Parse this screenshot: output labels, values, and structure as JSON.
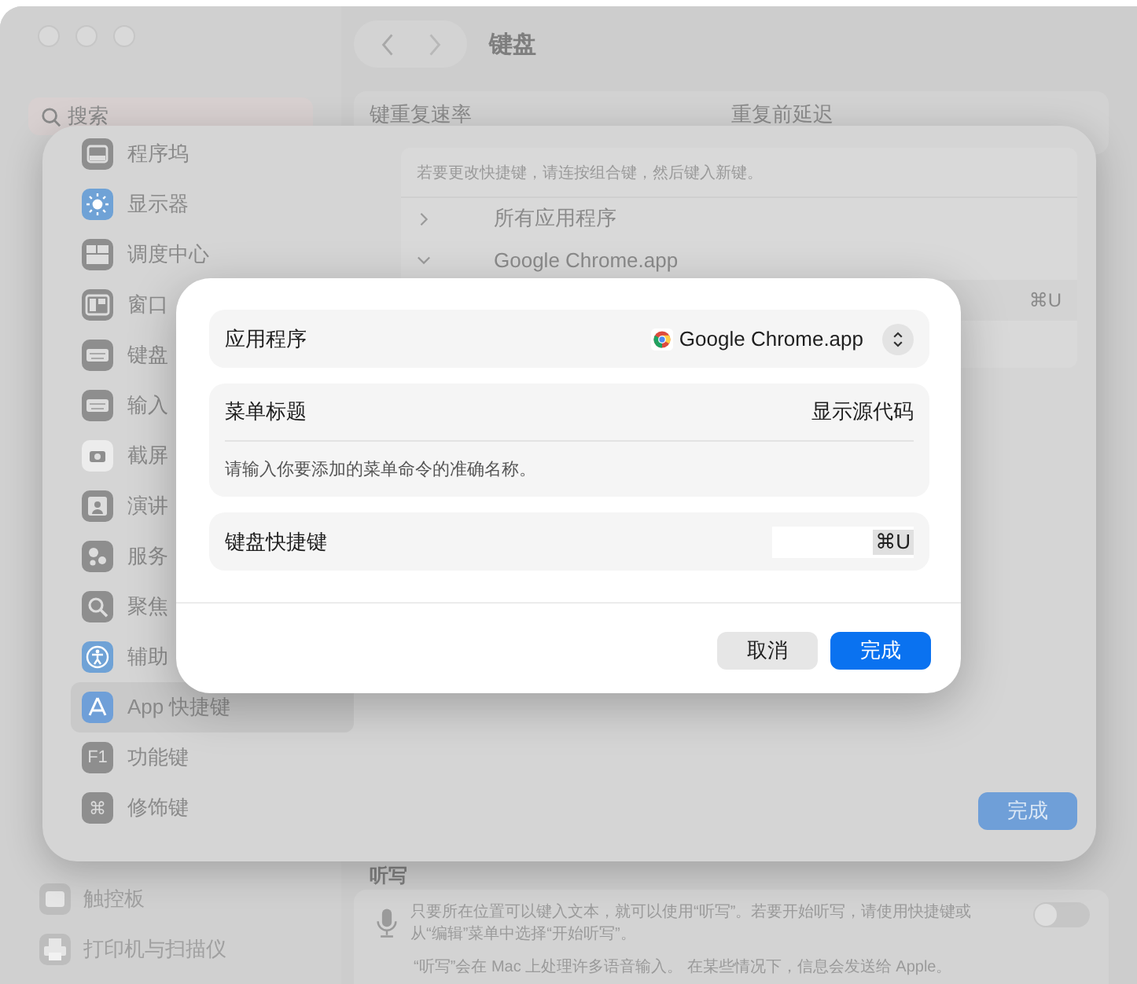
{
  "window": {
    "title": "键盘",
    "search": {
      "placeholder": "搜索"
    },
    "sidebar_items": [
      {
        "label": "触控板",
        "kind": "trackpad"
      },
      {
        "label": "打印机与扫描仪",
        "kind": "printer"
      }
    ],
    "key_repeat": {
      "labels": [
        "键重复速率",
        "重复前延迟"
      ]
    },
    "dictation": {
      "title": "听写",
      "description": "只要所在位置可以键入文本，就可以使用“听写”。若要开始听写，请使用快捷键或从“编辑”菜单中选择“开始听写”。",
      "note": "“听写”会在 Mac 上处理许多语音输入。 在某些情况下，信息会发送给 Apple。",
      "on": false
    }
  },
  "sheet": {
    "sidebar": [
      {
        "label": "程序坞",
        "kind": "dock",
        "selected": false
      },
      {
        "label": "显示器",
        "kind": "display",
        "selected": false
      },
      {
        "label": "调度中心",
        "kind": "mission",
        "selected": false
      },
      {
        "label": "窗口",
        "kind": "window",
        "selected": false
      },
      {
        "label": "键盘",
        "kind": "keyboard",
        "selected": false
      },
      {
        "label": "输入",
        "kind": "keyboard",
        "selected": false
      },
      {
        "label": "截屏",
        "kind": "screenshot",
        "selected": false
      },
      {
        "label": "演讲",
        "kind": "presenter",
        "selected": false
      },
      {
        "label": "服务",
        "kind": "services",
        "selected": false
      },
      {
        "label": "聚焦",
        "kind": "spotlight",
        "selected": false
      },
      {
        "label": "辅助",
        "kind": "accessibility",
        "selected": false
      },
      {
        "label": "App 快捷键",
        "kind": "appstore",
        "selected": true
      },
      {
        "label": "功能键",
        "kind": "glyph",
        "glyph": "F1",
        "selected": false
      },
      {
        "label": "修饰键",
        "kind": "glyph",
        "glyph": "⌘",
        "selected": false
      }
    ],
    "hint": "若要更改快捷键，请连按组合键，然后键入新键。",
    "rows": [
      {
        "kind": "group",
        "label": "所有应用程序",
        "expanded": false
      },
      {
        "kind": "group",
        "label": "Google Chrome.app",
        "expanded": true
      },
      {
        "kind": "shortcut",
        "shortcut": "⌘U"
      }
    ],
    "done_button": "完成"
  },
  "dialog": {
    "application": {
      "label": "应用程序",
      "value": "Google Chrome.app"
    },
    "menu_title": {
      "label": "菜单标题",
      "value": "显示源代码",
      "help": "请输入你要添加的菜单命令的准确名称。"
    },
    "shortcut": {
      "label": "键盘快捷键",
      "value": "⌘U"
    },
    "buttons": [
      {
        "label": "取消",
        "kind": "secondary"
      },
      {
        "label": "完成",
        "kind": "primary"
      }
    ]
  }
}
